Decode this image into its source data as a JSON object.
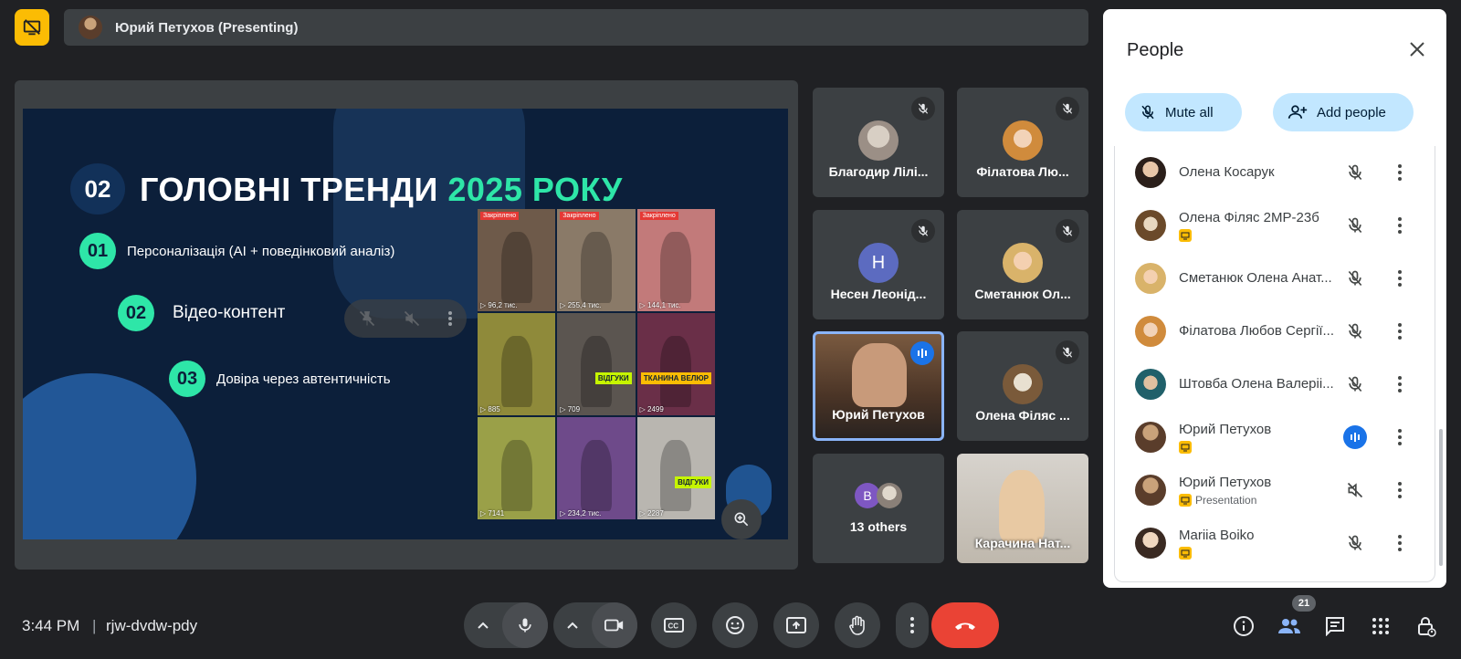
{
  "top": {
    "presenting_label": "Юрий Петухов (Presenting)"
  },
  "slide": {
    "section_num": "02",
    "title_main": "ГОЛОВНІ ТРЕНДИ ",
    "title_accent": "2025 РОКУ",
    "points": [
      {
        "num": "01",
        "text": "Персоналізація (AI + поведінковий аналіз)"
      },
      {
        "num": "02",
        "text": "Відео-контент"
      },
      {
        "num": "03",
        "text": "Довіра через автентичність"
      }
    ],
    "thumbs": [
      {
        "tag": "Закріплено",
        "views": "▷ 96,2 тис."
      },
      {
        "tag": "Закріплено",
        "views": "▷ 255,4 тис."
      },
      {
        "tag": "Закріплено",
        "views": "▷ 144,1 тис."
      },
      {
        "tag": "",
        "views": "▷ 885",
        "badge": ""
      },
      {
        "tag": "",
        "views": "▷ 709",
        "badge": "ВІДГУКИ"
      },
      {
        "tag": "",
        "views": "▷ 2499",
        "badge": "ТКАНИНА ВЕЛЮР"
      },
      {
        "tag": "",
        "views": "▷ 7141"
      },
      {
        "tag": "",
        "views": "▷ 234,2 тис."
      },
      {
        "tag": "",
        "views": "▷ 2287",
        "badge": "ВІДГУКИ"
      }
    ]
  },
  "tiles": [
    {
      "name": "Благодир Лілі..."
    },
    {
      "name": "Філатова Лю..."
    },
    {
      "name": "Несен Леонід...",
      "initial": "Н"
    },
    {
      "name": "Сметанюк Ол..."
    },
    {
      "name": "Юрий Петухов"
    },
    {
      "name": "Олена Філяс ..."
    },
    {
      "name": "13 others",
      "initial": "В"
    },
    {
      "name": "Карачина Нат..."
    }
  ],
  "panel": {
    "title": "People",
    "mute_all": "Mute all",
    "add_people": "Add people",
    "people": [
      {
        "name": "Олена Косарук",
        "sub": ""
      },
      {
        "name": "Олена Філяс 2МР-23б",
        "sub": ""
      },
      {
        "name": "Сметанюк Олена Анат...",
        "sub": ""
      },
      {
        "name": "Філатова Любов Сергії...",
        "sub": ""
      },
      {
        "name": "Штовба Олена Валеріі...",
        "sub": ""
      },
      {
        "name": "Юрий Петухов",
        "sub": ""
      },
      {
        "name": "Юрий Петухов",
        "sub": "Presentation"
      },
      {
        "name": "Mariia Boiko",
        "sub": ""
      }
    ]
  },
  "bottom": {
    "time": "3:44 PM",
    "separator": "|",
    "meeting_code": "rjw-dvdw-pdy",
    "participants_count": "21"
  }
}
